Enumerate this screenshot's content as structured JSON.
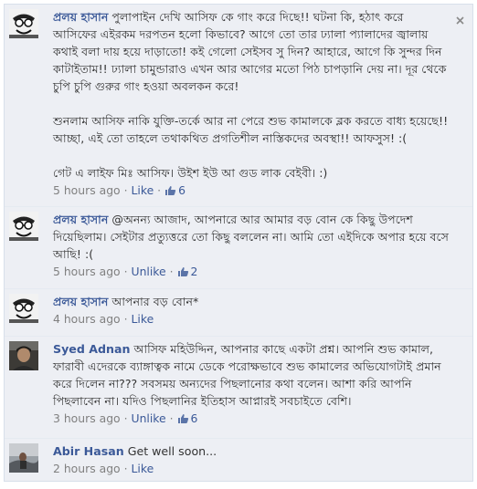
{
  "comments": [
    {
      "author": "প্রলয় হাসান",
      "text": "পুলাপাইন দেখি আসিফ কে গাং করে দিছে!! ঘটনা কি, হঠাৎ করে আসিফের এইরকম দরপতন হলো কিভাবে? আগে তো তার ঢ্যালা প্যালাদের জ্বালায় কথাই বলা দায় হয়ে দাড়াতো! কই গেলো সেইসব সু দিন? আহারে, আগে কি সুন্দর দিন কাটাইতাম!! ঢ্যালা চামুন্ডারাও এখন আর আগের মতো পিঠ চাপড়ানি দেয় না। দূর থেকে চুপি চুপি গুরুর গাং হওয়া অবলকন করে!\n\nশুনলাম আসিফ নাকি যুক্তি-তর্কে আর না পেরে শুভ কামালকে ব্লক করতে বাধ্য হয়েছে!! আচ্ছা, এই তো তাহলে তথাকথিত প্রগতিশীল নাস্তিকদের অবস্থা!! আফসুস! :(\n\nগেট এ লাইফ মিঃ আসিফ। উইশ ইউ আ গুড লাক বেইবী। :)",
      "time": "5 hours ago",
      "action": "Like",
      "likes": "6",
      "avatar": "cartoon-face",
      "close_icon": true
    },
    {
      "author": "প্রলয় হাসান",
      "text": "@অনন্য আজাদ, আপনারে আর আমার বড় বোন কে কিছু উপদেশ দিয়েছিলাম। সেইটার প্রত্যুত্তরে তো কিছু বললেন না। আমি তো এইদিকে অপার হয়ে বসে আছি! :(",
      "time": "5 hours ago",
      "action": "Unlike",
      "likes": "2",
      "avatar": "cartoon-face"
    },
    {
      "author": "প্রলয় হাসান",
      "text": "আপনার বড় বোন*",
      "time": "4 hours ago",
      "action": "Like",
      "likes": null,
      "avatar": "cartoon-face"
    },
    {
      "author": "Syed Adnan",
      "text": "আসিফ মহিউদ্দিন, আপনার কাছে একটা প্রশ্ন। আপনি শুভ কামাল, ফারাবী এদেরকে ব্যাঙ্গাত্বক নামে ডেকে পরোক্ষভাবে শুভ কামালের অভিযোগটাই প্রমান করে দিলেন না??? সবসময় অন্যদের পিছলানোর কথা বলেন। আশা করি আপনি পিছলাবেন না। যদিও পিছলানির ইতিহাস আপ্নারই সবচাইতে বেশি।",
      "time": "3 hours ago",
      "action": "Unlike",
      "likes": "6",
      "avatar": "photo-portrait"
    },
    {
      "author": "Abir Hasan",
      "text": "Get well soon...",
      "time": "2 hours ago",
      "action": "Like",
      "likes": null,
      "avatar": "photo-landscape"
    }
  ],
  "separator": "·",
  "colors": {
    "background": "#edeff4",
    "link": "#3b5998",
    "meta": "#808080",
    "text": "#333333"
  }
}
